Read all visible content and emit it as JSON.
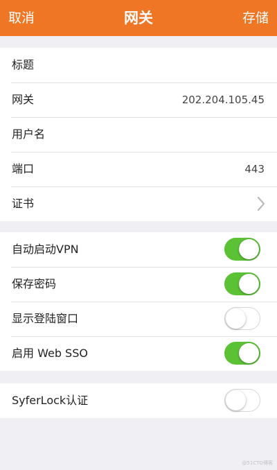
{
  "nav": {
    "cancel": "取消",
    "title": "网关",
    "save": "存储"
  },
  "fields": {
    "title_label": "标题",
    "gateway_label": "网关",
    "gateway_value": "202.204.105.45",
    "username_label": "用户名",
    "port_label": "端口",
    "port_value": "443",
    "certificate_label": "证书"
  },
  "toggles": {
    "auto_start_vpn": {
      "label": "自动启动VPN",
      "on": true
    },
    "save_password": {
      "label": "保存密码",
      "on": true
    },
    "show_login_window": {
      "label": "显示登陆窗口",
      "on": false
    },
    "enable_web_sso": {
      "label": "启用 Web SSO",
      "on": true
    },
    "syferlock": {
      "label": "SyferLock认证",
      "on": false
    }
  },
  "watermark": "@51CTO博客",
  "colors": {
    "nav_background": "#ee7624",
    "toggle_on": "#5bc236",
    "page_background": "#efeff4"
  }
}
